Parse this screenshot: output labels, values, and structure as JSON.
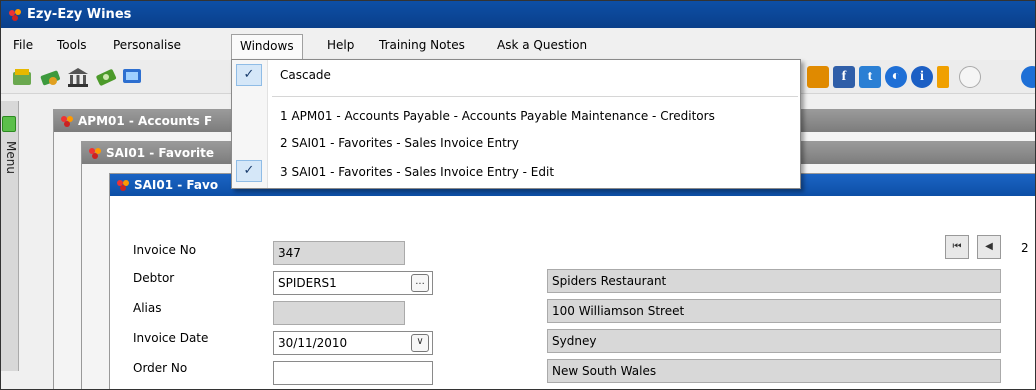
{
  "app": {
    "title": "Ezy-Ezy Wines"
  },
  "menubar": {
    "items": [
      "File",
      "Tools",
      "Personalise",
      "Windows",
      "Help",
      "Training Notes",
      "Ask a Question"
    ],
    "active": "Windows"
  },
  "toolbar": {
    "icons": [
      "accounts-icon",
      "payments-icon",
      "bank-icon",
      "cash-icon",
      "screen-icon",
      "facebook-icon",
      "twitter-icon",
      "web-icon",
      "info-icon",
      "bookmark-icon"
    ],
    "facebook_glyph": "f",
    "twitter_glyph": "t",
    "info_glyph": "i"
  },
  "sidebar": {
    "label": "Menu"
  },
  "windows_menu": {
    "cascade": "Cascade",
    "items": [
      "1 APM01 - Accounts Payable - Accounts Payable Maintenance -  Creditors",
      "2 SAI01 - Favorites -  Sales Invoice Entry",
      "3 SAI01 - Favorites -  Sales Invoice Entry - Edit"
    ],
    "checkmark": "✓"
  },
  "mdi": {
    "win1_title": "APM01 - Accounts F",
    "win2_title": "SAI01 - Favorite",
    "win3_title": "SAI01 - Favo"
  },
  "nav": {
    "first": "⏮",
    "prev": "◀",
    "page": "2"
  },
  "form": {
    "invoice_no_label": "Invoice No",
    "invoice_no": "347",
    "debtor_label": "Debtor",
    "debtor": "SPIDERS1",
    "alias_label": "Alias",
    "alias": "",
    "invoice_date_label": "Invoice Date",
    "invoice_date": "30/11/2010",
    "order_no_label": "Order No",
    "order_no": "",
    "lookup_glyph": "...",
    "dropdown_glyph": "∨",
    "address": [
      "Spiders Restaurant",
      "100 Williamson Street",
      "Sydney",
      "New South Wales"
    ]
  },
  "colors": {
    "title_bar": "#0d4fa6",
    "active_window_title": "#1b64c4",
    "inactive_window_title": "#8a8a8a",
    "check_highlight": "#d5e7f8"
  }
}
